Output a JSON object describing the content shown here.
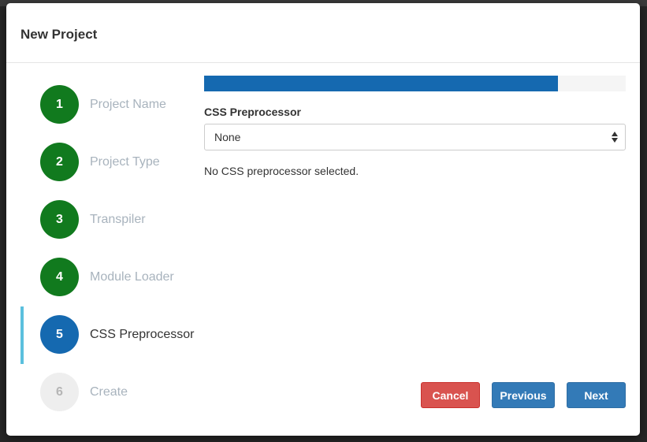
{
  "modal": {
    "title": "New Project"
  },
  "steps": [
    {
      "number": "1",
      "label": "Project Name",
      "state": "done"
    },
    {
      "number": "2",
      "label": "Project Type",
      "state": "done"
    },
    {
      "number": "3",
      "label": "Transpiler",
      "state": "done"
    },
    {
      "number": "4",
      "label": "Module Loader",
      "state": "done"
    },
    {
      "number": "5",
      "label": "CSS Preprocessor",
      "state": "current"
    },
    {
      "number": "6",
      "label": "Create",
      "state": "pending"
    }
  ],
  "progress": {
    "percent": 84
  },
  "form": {
    "field_label": "CSS Preprocessor",
    "select_value": "None",
    "help_text": "No CSS preprocessor selected."
  },
  "buttons": {
    "cancel": "Cancel",
    "previous": "Previous",
    "next": "Next"
  },
  "colors": {
    "done": "#117a1e",
    "current": "#1569b0",
    "cancel": "#d9534f",
    "primary": "#337ab7"
  }
}
